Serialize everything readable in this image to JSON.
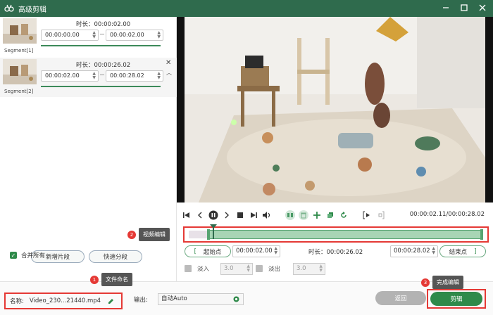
{
  "window": {
    "title": "高级剪辑"
  },
  "segments": [
    {
      "label": "Segment[1]",
      "duration": "时长：00:00:02.00",
      "start": "00:00:00.00",
      "end": "00:00:02.00"
    },
    {
      "label": "Segment[2]",
      "duration": "时长：00:00:26.02",
      "start": "00:00:02.00",
      "end": "00:00:28.02"
    }
  ],
  "left_buttons": {
    "add_segment": "新增片段",
    "quick_split": "快速分段"
  },
  "merge_all": {
    "label": "合并所有",
    "checked": true
  },
  "player": {
    "timecode": "00:00:02.11/00:00:28.02"
  },
  "range": {
    "start_label": "起始点",
    "start_value": "00:00:02.00",
    "duration": "时长：00:00:26.02",
    "end_value": "00:00:28.02",
    "end_label": "结束点"
  },
  "fade": {
    "fade_in_label": "淡入",
    "fade_in_value": "3.0",
    "fade_out_label": "淡出",
    "fade_out_value": "3.0"
  },
  "bottom": {
    "name_label": "名称:",
    "name_value": "Video_230...21440.mp4",
    "output_label": "输出:",
    "output_value": "自动Auto",
    "back_button": "返回",
    "cut_button": "剪辑"
  },
  "callouts": [
    {
      "number": "1",
      "text": "文件命名"
    },
    {
      "number": "2",
      "text": "视频编辑"
    },
    {
      "number": "3",
      "text": "完成编辑"
    }
  ],
  "colors": {
    "titlebar": "#2f6b4d",
    "accent": "#2f8a4a",
    "highlight": "#e53935"
  }
}
